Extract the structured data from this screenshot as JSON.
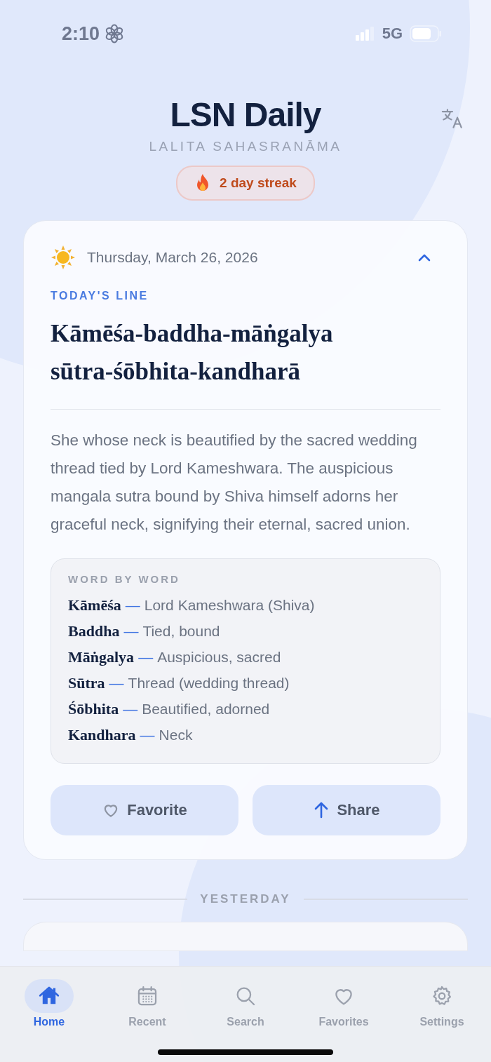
{
  "status_bar": {
    "time": "2:10",
    "network": "5G"
  },
  "header": {
    "title": "LSN Daily",
    "subtitle": "LALITA SAHASRANĀMA",
    "streak": "2 day streak"
  },
  "today_card": {
    "date": "Thursday, March 26, 2026",
    "expanded": true,
    "label": "TODAY'S LINE",
    "line": [
      "Kāmēśa-baddha-māṅgalya",
      "sūtra-śōbhita-kandharā"
    ],
    "meaning": "She whose neck is beautified by the sacred wedding thread tied by Lord Kameshwara. The auspicious mangala sutra bound by Shiva himself adorns her graceful neck, signifying their eternal, sacred union.",
    "word_by_word": {
      "title": "WORD BY WORD",
      "separator": "—",
      "rows": [
        {
          "term": "Kāmēśa",
          "meaning": "Lord Kameshwara (Shiva)"
        },
        {
          "term": "Baddha",
          "meaning": "Tied, bound"
        },
        {
          "term": "Māṅgalya",
          "meaning": "Auspicious, sacred"
        },
        {
          "term": "Sūtra",
          "meaning": "Thread (wedding thread)"
        },
        {
          "term": "Śōbhita",
          "meaning": "Beautified, adorned"
        },
        {
          "term": "Kandhara",
          "meaning": "Neck"
        }
      ]
    },
    "actions": [
      {
        "kind": "favorite",
        "label": "Favorite"
      },
      {
        "kind": "share",
        "label": "Share"
      }
    ]
  },
  "section_label": "YESTERDAY",
  "tab_bar": [
    {
      "kind": "home",
      "label": "Home",
      "selected": true
    },
    {
      "kind": "recent",
      "label": "Recent",
      "selected": false
    },
    {
      "kind": "search",
      "label": "Search",
      "selected": false
    },
    {
      "kind": "favorites",
      "label": "Favorites",
      "selected": false
    },
    {
      "kind": "settings",
      "label": "Settings",
      "selected": false
    }
  ]
}
